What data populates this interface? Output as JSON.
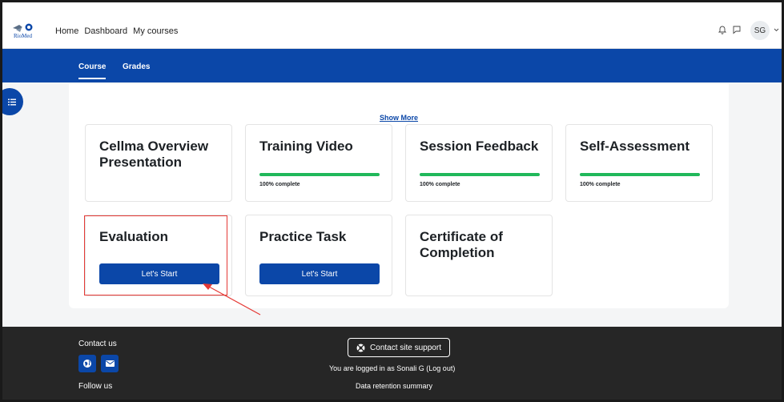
{
  "nav": {
    "home": "Home",
    "dashboard": "Dashboard",
    "my_courses": "My courses"
  },
  "logo": {
    "text": "RioMed"
  },
  "user": {
    "initials": "SG"
  },
  "tabs": [
    {
      "label": "Course"
    },
    {
      "label": "Grades"
    }
  ],
  "show_more": "Show More",
  "cards": [
    {
      "title": "Cellma Overview Presentation"
    },
    {
      "title": "Training Video",
      "progress": 100,
      "progress_label": "100% complete"
    },
    {
      "title": "Session Feedback",
      "progress": 100,
      "progress_label": "100% complete"
    },
    {
      "title": "Self-Assessment",
      "progress": 100,
      "progress_label": "100% complete"
    },
    {
      "title": "Evaluation",
      "button": "Let's Start"
    },
    {
      "title": "Practice Task",
      "button": "Let's Start"
    },
    {
      "title": "Certificate of Completion"
    }
  ],
  "footer": {
    "contact_us": "Contact us",
    "follow_us": "Follow us",
    "support_button": "Contact site support",
    "logged_in_prefix": "You are logged in as",
    "user_name": "Sonali G",
    "logout": "(Log out)",
    "data_retention": "Data retention summary"
  },
  "colors": {
    "primary": "#0b47a8",
    "progress": "#20b85a",
    "footer": "#262626",
    "highlight": "#e53935"
  },
  "icons": {
    "bell": "bell-icon",
    "chat": "chat-bubble-icon",
    "drawer": "list-icon",
    "globe": "globe-icon",
    "mail": "envelope-icon",
    "support": "lifebuoy-icon"
  }
}
